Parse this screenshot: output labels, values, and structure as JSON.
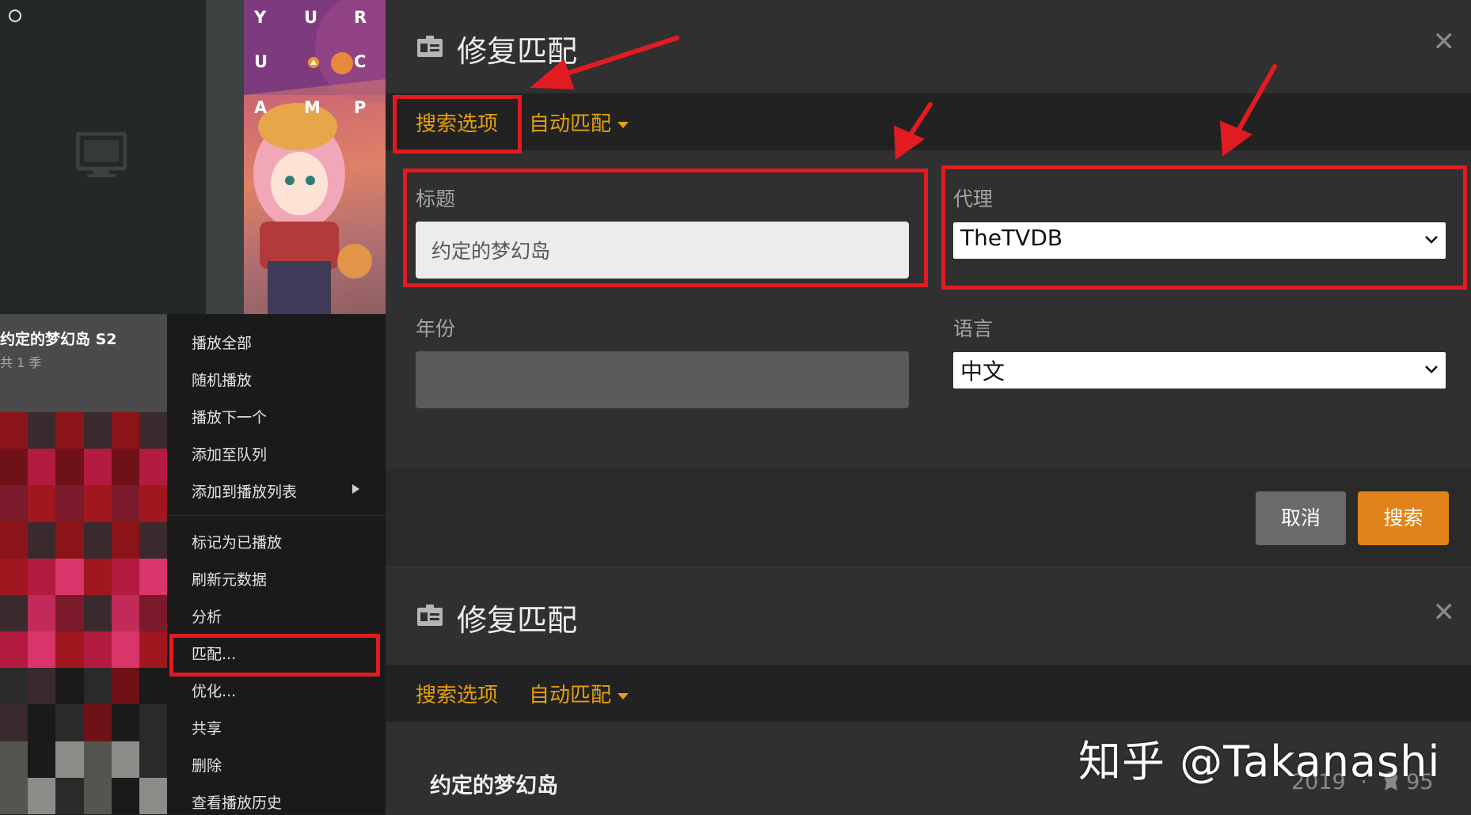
{
  "library": {
    "show_title": "约定的梦幻岛 S2",
    "show_subtitle": "共 1 季",
    "poster_letters": [
      "Y",
      "U",
      "R",
      "U",
      "C",
      "A",
      "M",
      "P"
    ]
  },
  "context_menu": {
    "items": [
      {
        "label": "播放全部"
      },
      {
        "label": "随机播放"
      },
      {
        "label": "播放下一个"
      },
      {
        "label": "添加至队列"
      },
      {
        "label": "添加到播放列表"
      },
      {
        "label": "标记为已播放"
      },
      {
        "label": "刷新元数据"
      },
      {
        "label": "分析"
      },
      {
        "label": "匹配..."
      },
      {
        "label": "优化..."
      },
      {
        "label": "共享"
      },
      {
        "label": "删除"
      },
      {
        "label": "查看播放历史"
      }
    ]
  },
  "dialog1": {
    "title": "修复匹配",
    "tabs": {
      "search_options": "搜索选项",
      "auto_match": "自动匹配"
    },
    "title_label": "标题",
    "title_value": "约定的梦幻岛",
    "agent_label": "代理",
    "agent_value": "TheTVDB",
    "year_label": "年份",
    "year_value": "",
    "language_label": "语言",
    "language_value": "中文",
    "cancel_label": "取消",
    "search_label": "搜索"
  },
  "dialog2": {
    "title": "修复匹配",
    "tabs": {
      "search_options": "搜索选项",
      "auto_match": "自动匹配"
    },
    "result_title": "约定的梦幻岛",
    "result_year": "2019",
    "result_separator": "·",
    "result_score": "95"
  },
  "watermark": "知乎 @Takanashi",
  "colors": {
    "accent": "#e5a00d",
    "search_button": "#e0831a",
    "annotation_red": "#e21b23",
    "dialog_bg": "#303030"
  }
}
